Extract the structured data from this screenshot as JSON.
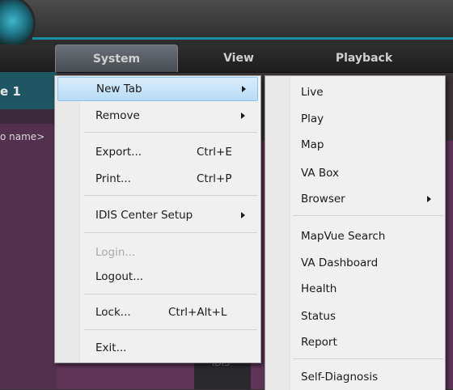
{
  "menubar": {
    "items": [
      {
        "label": "System",
        "active": true
      },
      {
        "label": "View",
        "active": false
      },
      {
        "label": "Playback",
        "active": false
      }
    ]
  },
  "background": {
    "tab_suffix": "e 1",
    "name_fragment": "o name>",
    "ghost_text": "IDIS"
  },
  "system_menu": {
    "items": [
      {
        "label": "New Tab",
        "submenu": true,
        "highlighted": true
      },
      {
        "label": "Remove",
        "submenu": true
      },
      {
        "label": "Export...",
        "shortcut": "Ctrl+E"
      },
      {
        "label": "Print...",
        "shortcut": "Ctrl+P"
      },
      {
        "label": "IDIS Center Setup",
        "submenu": true
      },
      {
        "label": "Login...",
        "disabled": true
      },
      {
        "label": "Logout..."
      },
      {
        "label": "Lock...",
        "shortcut": "Ctrl+Alt+L"
      },
      {
        "label": "Exit..."
      }
    ]
  },
  "newtab_submenu": {
    "items": [
      {
        "label": "Live"
      },
      {
        "label": "Play"
      },
      {
        "label": "Map"
      },
      {
        "label": "VA Box"
      },
      {
        "label": "Browser",
        "submenu": true
      },
      {
        "label": "MapVue Search"
      },
      {
        "label": "VA Dashboard"
      },
      {
        "label": "Health"
      },
      {
        "label": "Status"
      },
      {
        "label": "Report"
      },
      {
        "label": "Self-Diagnosis"
      }
    ]
  },
  "colors": {
    "accent": "#1a8ea0",
    "highlight": "#b8dcf7",
    "menu_bg": "#f0f0f0",
    "purple_bg": "#5e3558"
  }
}
